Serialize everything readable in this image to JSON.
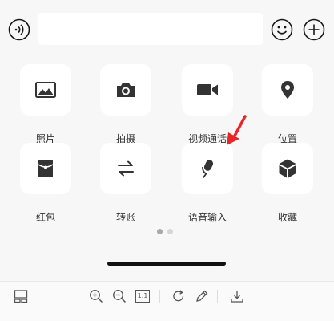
{
  "input_bar": {
    "message_value": "",
    "voice_icon": "voice-icon",
    "emoji_icon": "emoji-icon",
    "add_icon": "add-icon"
  },
  "panel": {
    "items": [
      {
        "label": "照片",
        "icon": "photo-icon"
      },
      {
        "label": "拍摄",
        "icon": "camera-icon"
      },
      {
        "label": "视频通话",
        "icon": "video-call-icon"
      },
      {
        "label": "位置",
        "icon": "location-icon"
      },
      {
        "label": "红包",
        "icon": "red-packet-icon"
      },
      {
        "label": "转账",
        "icon": "transfer-icon"
      },
      {
        "label": "语音输入",
        "icon": "microphone-icon"
      },
      {
        "label": "收藏",
        "icon": "favorites-icon"
      }
    ],
    "page_count": 2,
    "active_page": 1
  },
  "toolbar": {
    "icons": [
      "layout-icon",
      "zoom-in-icon",
      "zoom-out-icon",
      "actual-size-icon",
      "rotate-icon",
      "edit-icon",
      "download-icon"
    ],
    "actual_size_label": "1:1"
  },
  "colors": {
    "annotation_arrow": "#e8262a",
    "icon": "#333333",
    "tile_background": "#ffffff",
    "panel_background": "#f7f7f7"
  }
}
